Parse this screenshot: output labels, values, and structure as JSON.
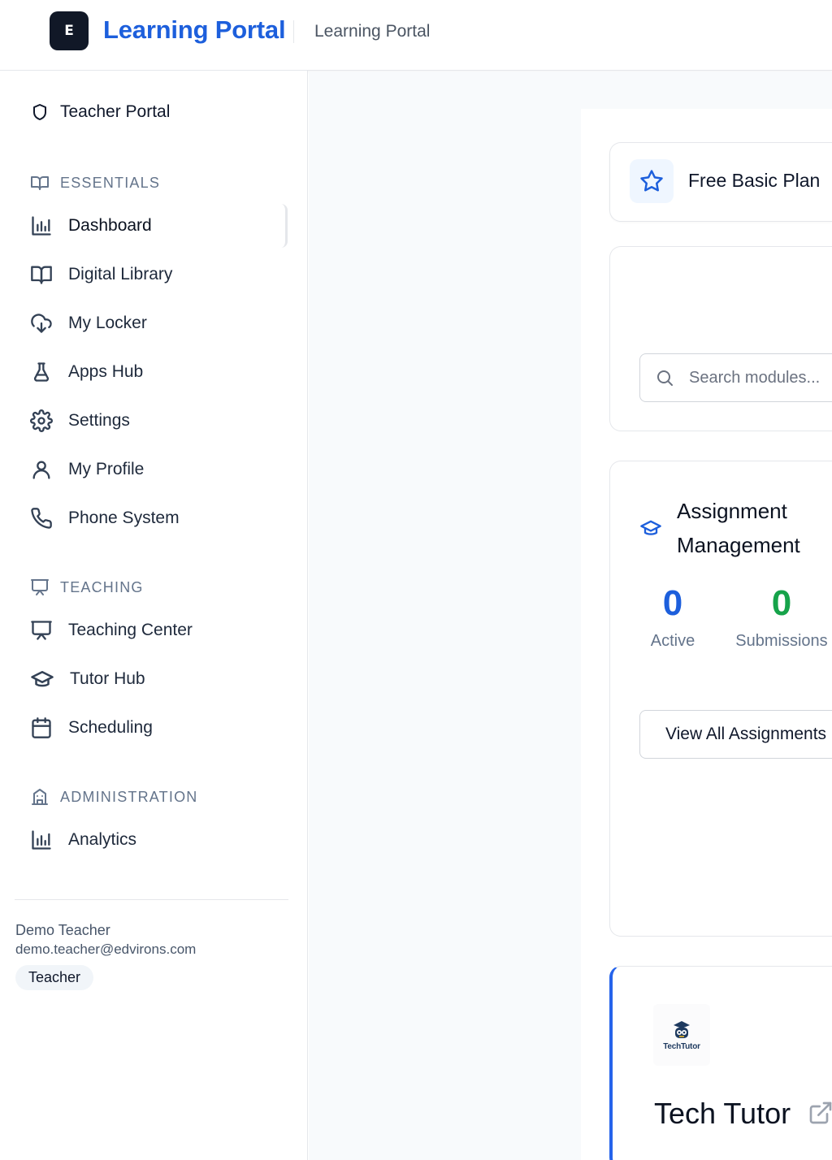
{
  "header": {
    "logo_letter": "E",
    "app_title": "Learning Portal",
    "subtitle": "Learning Portal"
  },
  "sidebar": {
    "portal_label": "Teacher Portal",
    "sections": [
      {
        "label": "ESSENTIALS",
        "icon": "book-open-icon"
      },
      {
        "label": "TEACHING",
        "icon": "presentation-icon"
      },
      {
        "label": "ADMINISTRATION",
        "icon": "building-icon"
      }
    ],
    "essentials": [
      {
        "label": "Dashboard",
        "icon": "bar-chart-icon",
        "active": true
      },
      {
        "label": "Digital Library",
        "icon": "book-open-icon"
      },
      {
        "label": "My Locker",
        "icon": "cloud-download-icon"
      },
      {
        "label": "Apps Hub",
        "icon": "flask-icon"
      },
      {
        "label": "Settings",
        "icon": "gear-icon"
      },
      {
        "label": "My Profile",
        "icon": "user-icon"
      },
      {
        "label": "Phone System",
        "icon": "phone-icon"
      }
    ],
    "teaching": [
      {
        "label": "Teaching Center",
        "icon": "presentation-icon"
      },
      {
        "label": "Tutor Hub",
        "icon": "graduation-cap-icon"
      },
      {
        "label": "Scheduling",
        "icon": "calendar-icon"
      }
    ],
    "administration": [
      {
        "label": "Analytics",
        "icon": "bar-chart-icon"
      }
    ],
    "user": {
      "name": "Demo Teacher",
      "email": "demo.teacher@edvirons.com",
      "role": "Teacher"
    }
  },
  "main": {
    "plan": {
      "label": "Free Basic Plan",
      "icon": "star-icon"
    },
    "search": {
      "placeholder": "Search modules..."
    },
    "assignments": {
      "title": "Assignment Management",
      "active_count": "0",
      "active_label": "Active",
      "submissions_count": "0",
      "submissions_label": "Submissions",
      "button_label": "View All Assignments"
    },
    "tutor": {
      "logo_text": "TechTutor",
      "title": "Tech Tutor",
      "icon": "external-link-icon"
    }
  },
  "colors": {
    "brand": "#1d5fdc",
    "success": "#16a34a",
    "accent_border": "#2563eb"
  }
}
